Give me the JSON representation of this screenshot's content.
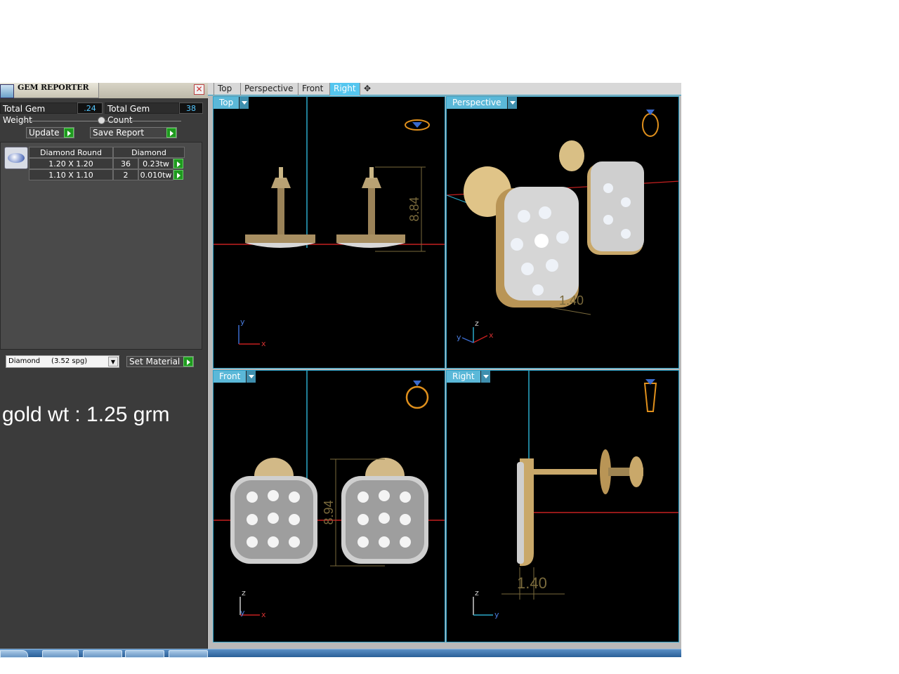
{
  "gem_reporter": {
    "title": "GEM REPORTER",
    "close_label": "✕",
    "total_weight_label": "Total Gem Weight",
    "total_weight_value": ".24",
    "total_count_label": "Total Gem Count",
    "total_count_value": "38",
    "update_label": "Update",
    "save_report_label": "Save Report",
    "table": {
      "headers": [
        "Diamond Round",
        "Diamond"
      ],
      "rows": [
        {
          "size": "1.20 X 1.20",
          "count": "36",
          "weight": "0.23tw"
        },
        {
          "size": "1.10 X 1.10",
          "count": "2",
          "weight": "0.010tw"
        }
      ]
    },
    "material_select_value": "Diamond     (3.52 spg)",
    "set_material_label": "Set Material"
  },
  "note": "gold wt : 1.25 grm",
  "viewport_tabs": [
    "Top",
    "Perspective",
    "Front",
    "Right",
    "✥"
  ],
  "active_tab": "Right",
  "viewports": {
    "top": {
      "label": "Top",
      "dimension": "8.84"
    },
    "perspective": {
      "label": "Perspective",
      "dimension": "1.40"
    },
    "front": {
      "label": "Front",
      "dimension": "8.94"
    },
    "right": {
      "label": "Right",
      "dimension": "1.40"
    }
  },
  "axes": {
    "x": "x",
    "y": "y",
    "z": "z"
  },
  "colors": {
    "panel_bg": "#3b3b3b",
    "accent": "#55c6ef",
    "viewport_bg": "#000000",
    "gold": "#c9a86a",
    "value_text": "#55c8ff"
  }
}
